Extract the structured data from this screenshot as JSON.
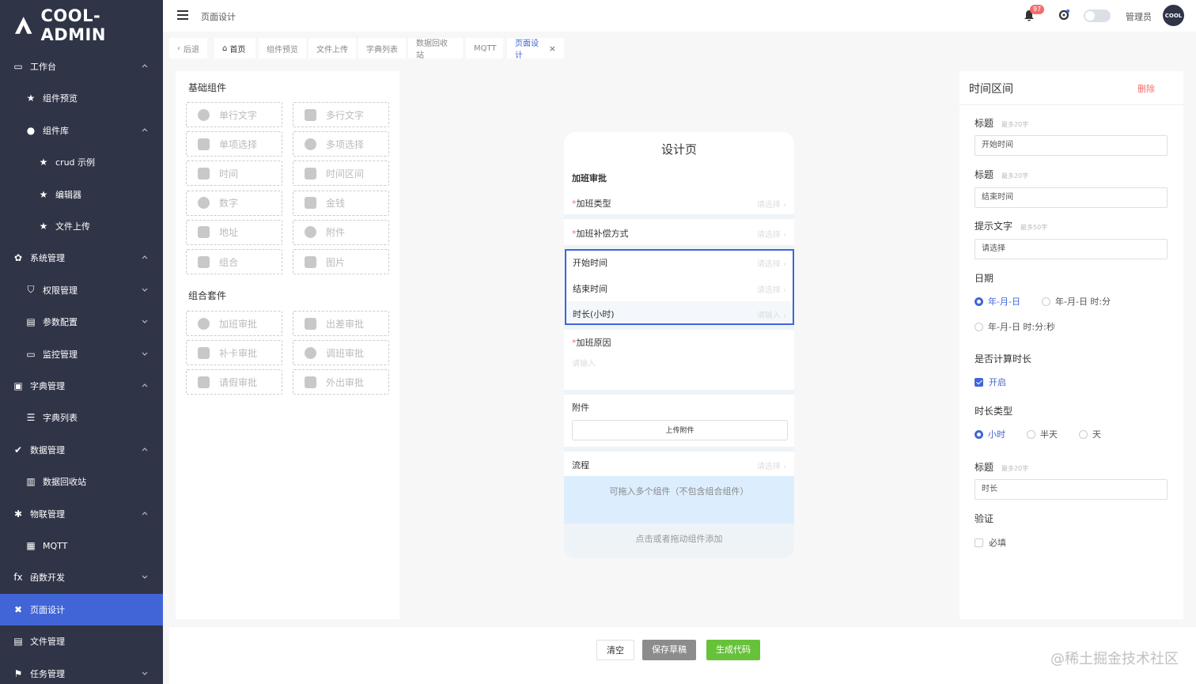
{
  "app": {
    "name": "COOL-ADMIN"
  },
  "sidebar": {
    "items": [
      {
        "label": "工作台",
        "icon": "monitor-icon",
        "arrow": "up"
      },
      {
        "label": "组件预览",
        "icon": "star-icon"
      },
      {
        "label": "组件库",
        "icon": "circle-icon",
        "arrow": "up"
      },
      {
        "label": "crud 示例",
        "icon": "star-icon"
      },
      {
        "label": "编辑器",
        "icon": "star-icon"
      },
      {
        "label": "文件上传",
        "icon": "star-icon"
      },
      {
        "label": "系统管理",
        "icon": "gear-icon",
        "arrow": "up"
      },
      {
        "label": "权限管理",
        "icon": "shield-icon",
        "arrow": "down"
      },
      {
        "label": "参数配置",
        "icon": "server-icon",
        "arrow": "down"
      },
      {
        "label": "监控管理",
        "icon": "monitor-icon",
        "arrow": "down"
      },
      {
        "label": "字典管理",
        "icon": "book-icon",
        "arrow": "up"
      },
      {
        "label": "字典列表",
        "icon": "list-icon"
      },
      {
        "label": "数据管理",
        "icon": "check-circle-icon",
        "arrow": "up"
      },
      {
        "label": "数据回收站",
        "icon": "trash-icon"
      },
      {
        "label": "物联管理",
        "icon": "snowflake-icon",
        "arrow": "up"
      },
      {
        "label": "MQTT",
        "icon": "calendar-icon"
      },
      {
        "label": "函数开发",
        "icon": "fx-icon",
        "arrow": "down"
      },
      {
        "label": "页面设计",
        "icon": "tools-icon",
        "active": true
      },
      {
        "label": "文件管理",
        "icon": "file-icon"
      },
      {
        "label": "任务管理",
        "icon": "flag-icon",
        "arrow": "down"
      }
    ]
  },
  "topbar": {
    "title": "页面设计",
    "notification_count": "97",
    "user_name": "管理员",
    "avatar_text": "COOL"
  },
  "tabs": [
    {
      "label": "后退"
    },
    {
      "label": "首页"
    },
    {
      "label": "组件预览"
    },
    {
      "label": "文件上传"
    },
    {
      "label": "字典列表"
    },
    {
      "label": "数据回收站"
    },
    {
      "label": "MQTT"
    },
    {
      "label": "页面设计",
      "active": true
    }
  ],
  "left_panel": {
    "basic_title": "基础组件",
    "basic": [
      "单行文字",
      "多行文字",
      "单项选择",
      "多项选择",
      "时间",
      "时间区间",
      "数字",
      "金钱",
      "地址",
      "附件",
      "组合",
      "图片"
    ],
    "suite_title": "组合套件",
    "suites": [
      "加班审批",
      "出差审批",
      "补卡审批",
      "调班审批",
      "请假审批",
      "外出审批"
    ]
  },
  "phone": {
    "header": "设计页",
    "form_title": "加班审批",
    "field_type": "加班类型",
    "field_comp": "加班补偿方式",
    "start": "开始时间",
    "end": "结束时间",
    "duration": "时长(小时)",
    "reason": "加班原因",
    "hint_select": "请选择",
    "hint_input": "请输入",
    "attach": "附件",
    "upload": "上传附件",
    "flow": "流程",
    "drop": "可拖入多个组件（不包含组合组件）",
    "drop_hint": "点击或者拖动组件添加"
  },
  "right_panel": {
    "title": "时间区间",
    "delete": "删除",
    "label_title": "标题",
    "max20": "最多20字",
    "start_value": "开始时间",
    "end_value": "结束时间",
    "hint_label": "提示文字",
    "max50": "最多50字",
    "hint_value": "请选择",
    "date_label": "日期",
    "date_opt1": "年-月-日",
    "date_opt2": "年-月-日 时:分",
    "date_opt3": "年-月-日 时:分:秒",
    "calc_label": "是否计算时长",
    "calc_on": "开启",
    "duration_type_label": "时长类型",
    "dur_opt1": "小时",
    "dur_opt2": "半天",
    "dur_opt3": "天",
    "dur_value": "时长",
    "valid_label": "验证",
    "required": "必填"
  },
  "bottom": {
    "clear": "清空",
    "save": "保存草稿",
    "generate": "生成代码",
    "watermark": "@稀土掘金技术社区"
  },
  "colors": {
    "sidebar_bg": "#2f3447",
    "accent": "#4165d7",
    "danger": "#f56c6c",
    "success": "#67c23a"
  }
}
